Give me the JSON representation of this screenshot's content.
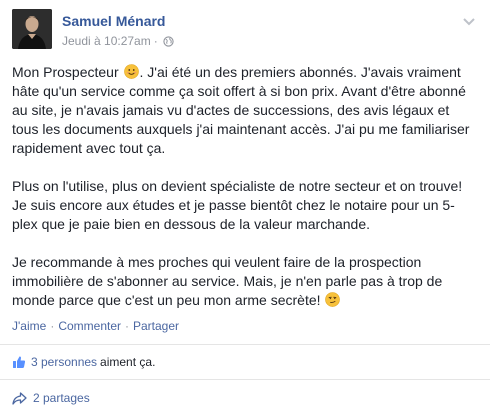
{
  "post": {
    "author": "Samuel Ménard",
    "timestamp": "Jeudi à 10:27am",
    "separator": "·",
    "privacy_icon": "globe-icon",
    "menu_icon": "chevron-down-icon"
  },
  "body": {
    "p1_a": "Mon Prospecteur ",
    "p1_emoji": "smiling-face-emoji",
    "p1_b": ". J'ai été un des premiers abonnés. J'avais vraiment hâte qu'un service comme ça soit offert à si bon prix. Avant d'être abonné au site, je n'avais jamais vu d'actes de successions, des avis légaux et tous les documents auxquels j'ai maintenant accès. J'ai pu me familiariser rapidement avec tout ça.",
    "p2": "Plus on l'utilise, plus on devient spécialiste de notre secteur et on trouve! Je suis encore aux études et je passe bientôt chez le notaire pour un 5-plex que je paie bien en dessous de la valeur marchande.",
    "p3_a": "Je recommande à mes proches qui veulent faire de la prospection immobilière de s'abonner au service. Mais, je n'en parle pas à trop de monde parce que c'est un peu mon arme secrète! ",
    "p3_emoji": "smirking-face-emoji"
  },
  "actions": {
    "like": "J'aime",
    "comment": "Commenter",
    "share": "Partager",
    "dot": "·"
  },
  "likes": {
    "icon": "thumbs-up-icon",
    "count_label": "3 personnes",
    "suffix": "aiment ça."
  },
  "shares": {
    "icon": "share-arrow-icon",
    "label": "2 partages"
  },
  "colors": {
    "link": "#365899",
    "action_link": "#4b67a1",
    "meta": "#90949c",
    "text": "#1d2129"
  }
}
